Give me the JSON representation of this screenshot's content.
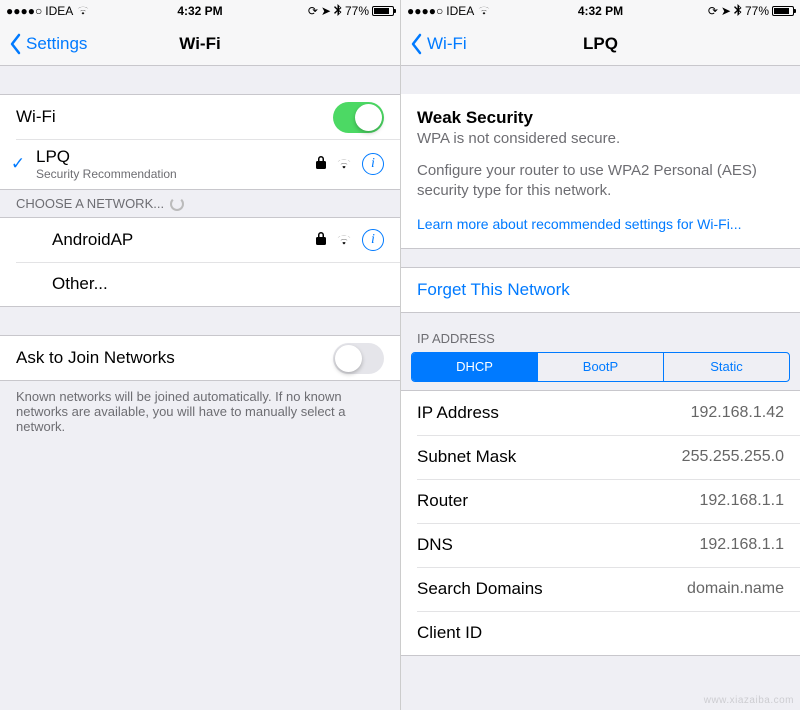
{
  "status": {
    "carrier": "IDEA",
    "time": "4:32 PM",
    "battery": "77%"
  },
  "left": {
    "back_label": "Settings",
    "title": "Wi-Fi",
    "wifi_label": "Wi-Fi",
    "wifi_on": true,
    "connected": {
      "name": "LPQ",
      "subtitle": "Security Recommendation"
    },
    "section_choose": "CHOOSE A NETWORK...",
    "networks": [
      {
        "name": "AndroidAP"
      }
    ],
    "other_label": "Other...",
    "ask_label": "Ask to Join Networks",
    "ask_on": false,
    "ask_footer": "Known networks will be joined automatically. If no known networks are available, you will have to manually select a network."
  },
  "right": {
    "back_label": "Wi-Fi",
    "title": "LPQ",
    "weak": {
      "title": "Weak Security",
      "subtitle": "WPA is not considered secure.",
      "desc": "Configure your router to use WPA2 Personal (AES) security type for this network.",
      "link": "Learn more about recommended settings for Wi-Fi..."
    },
    "forget_label": "Forget This Network",
    "ip_header": "IP ADDRESS",
    "segments": [
      "DHCP",
      "BootP",
      "Static"
    ],
    "segment_active": 0,
    "ip_rows": [
      {
        "label": "IP Address",
        "value": "192.168.1.42"
      },
      {
        "label": "Subnet Mask",
        "value": "255.255.255.0"
      },
      {
        "label": "Router",
        "value": "192.168.1.1"
      },
      {
        "label": "DNS",
        "value": "192.168.1.1"
      },
      {
        "label": "Search Domains",
        "value": "domain.name"
      },
      {
        "label": "Client ID",
        "value": ""
      }
    ]
  },
  "watermark": "www.xiazaiba.com"
}
